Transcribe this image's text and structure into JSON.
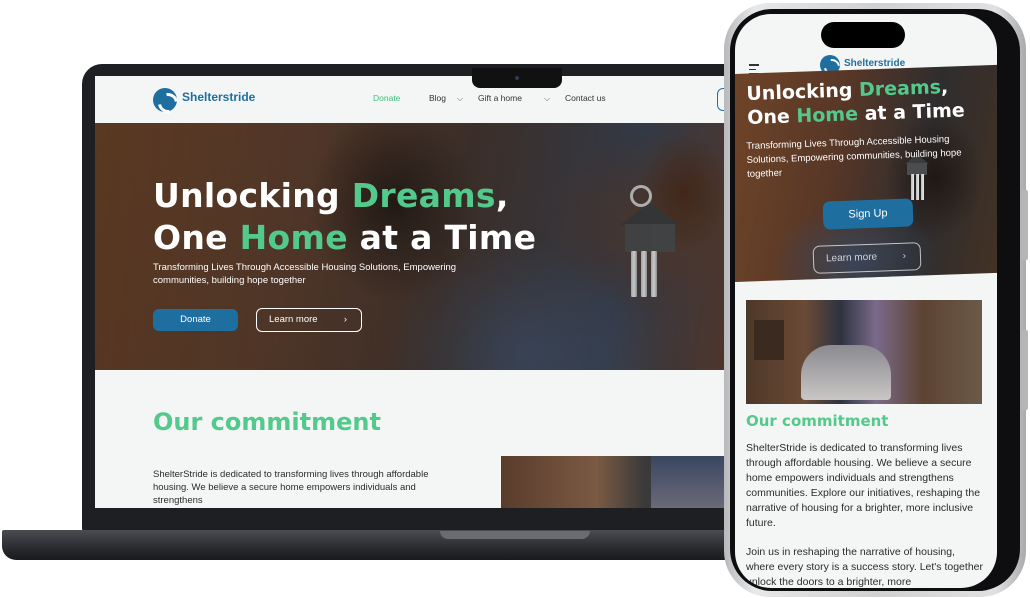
{
  "brand": {
    "name": "Shelterstride",
    "primary": "#1e6fa0",
    "accent": "#54c98c"
  },
  "laptop": {
    "nav": {
      "links": [
        {
          "label": "Donate",
          "active": true
        },
        {
          "label": "Blog",
          "dropdown": true
        },
        {
          "label": "Gift a home",
          "dropdown": true
        },
        {
          "label": "Contact us"
        }
      ]
    },
    "hero": {
      "title_line1_a": "Unlocking ",
      "title_line1_b": "Dreams",
      "title_line1_c": ",",
      "title_line2_a": "One ",
      "title_line2_b": "Home",
      "title_line2_c": " at a Time",
      "subtitle": "Transforming Lives Through Accessible Housing Solutions, Empowering communities, building hope together",
      "donate_label": "Donate",
      "learn_label": "Learn more",
      "arrow": "›"
    },
    "commitment": {
      "title": "Our commitment",
      "text": "ShelterStride is dedicated to transforming lives through affordable housing. We believe a secure home empowers individuals and strengthens"
    }
  },
  "phone": {
    "hero": {
      "title_line1_a": "Unlocking ",
      "title_line1_b": "Dreams",
      "title_line1_c": ",",
      "title_line2_a": "One ",
      "title_line2_b": "Home",
      "title_line2_c": " at a Time",
      "subtitle": "Transforming Lives Through Accessible Housing Solutions, Empowering communities, building hope together",
      "signup_label": "Sign Up",
      "learn_label": "Learn more",
      "arrow": "›"
    },
    "commitment": {
      "title": "Our commitment",
      "text": "ShelterStride is dedicated to transforming lives through affordable housing. We believe a secure home empowers individuals and strengthens communities. Explore our initiatives, reshaping the narrative of housing for a brighter, more inclusive future.",
      "text2": "Join us in reshaping the narrative of housing, where every story is a success story. Let's together unlock the doors to a brighter, more"
    }
  },
  "icons": {
    "menu": "hamburger-icon",
    "chevron": "chevron-down-icon",
    "logo": "shelterstride-logo-icon"
  }
}
